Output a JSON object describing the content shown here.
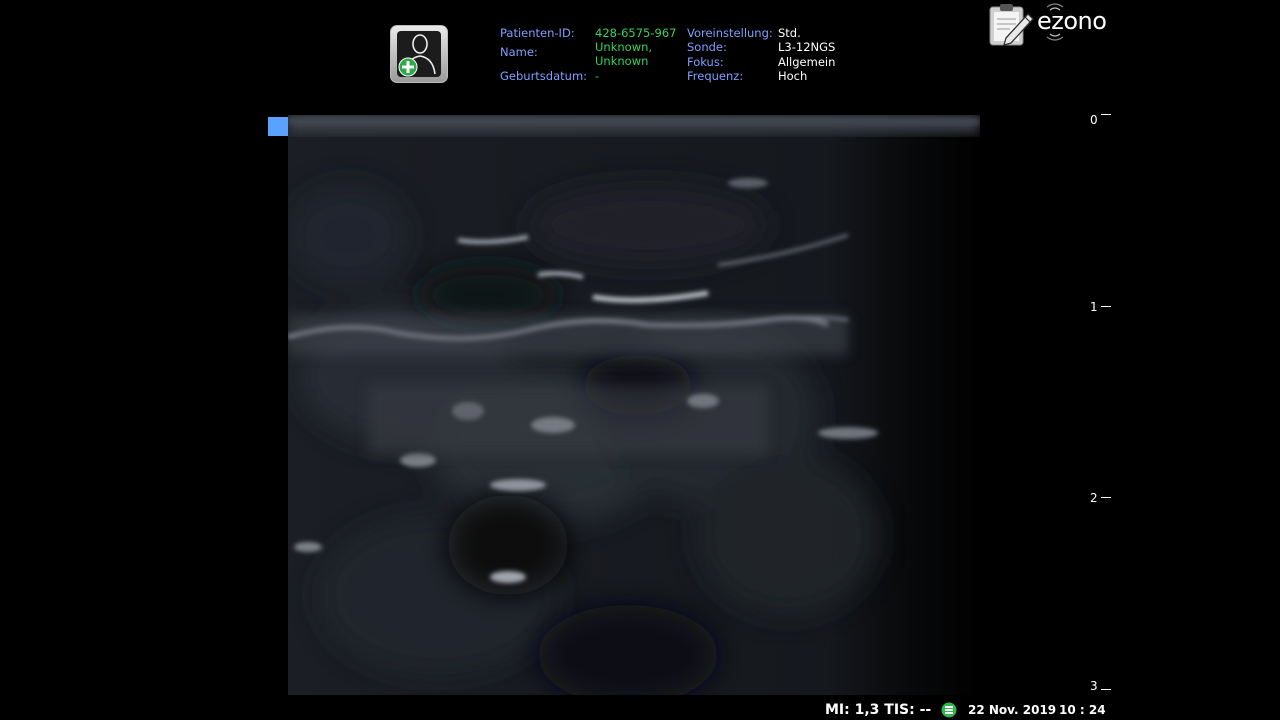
{
  "header": {
    "patient_button_icon": "patient-add-icon",
    "labels": {
      "patient_id": "Patienten-ID:",
      "name": "Name:",
      "birthdate": "Geburtsdatum:",
      "preset": "Voreinstellung:",
      "probe": "Sonde:",
      "focus": "Fokus:",
      "frequency": "Frequenz:"
    },
    "values": {
      "patient_id": "428-6575-967",
      "name_line1": "Unknown,",
      "name_line2": "Unknown",
      "birthdate": "-",
      "preset": "Std.",
      "probe": "L3-12NGS",
      "focus": "Allgemein",
      "frequency": "Hoch"
    },
    "logo": {
      "text": "ezono",
      "icon": "clipboard-pen-icon"
    }
  },
  "image": {
    "orientation_marker_color": "#5aa2ff"
  },
  "depth_scale": {
    "ticks": [
      "0",
      "1",
      "2",
      "3"
    ]
  },
  "status_bar": {
    "mi_tis": "MI: 1,3 TIS: --",
    "battery_icon": "battery-icon",
    "date": "22 Nov. 2019",
    "time": "10 : 24"
  },
  "colors": {
    "label_blue": "#7f9fff",
    "value_green": "#33d35c",
    "marker_blue": "#5aa2ff"
  }
}
